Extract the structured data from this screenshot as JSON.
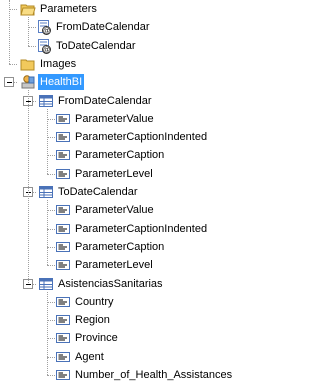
{
  "tree": {
    "parameters_folder": {
      "label": "Parameters",
      "icon": "folder-open-icon",
      "children": [
        {
          "label": "FromDateCalendar",
          "icon": "parameter-icon"
        },
        {
          "label": "ToDateCalendar",
          "icon": "parameter-icon"
        }
      ]
    },
    "images_folder": {
      "label": "Images",
      "icon": "folder-icon"
    },
    "datasource": {
      "label": "HealthBI",
      "icon": "data-source-icon",
      "selected": true,
      "datasets": [
        {
          "label": "FromDateCalendar",
          "icon": "dataset-icon",
          "fields": [
            "ParameterValue",
            "ParameterCaptionIndented",
            "ParameterCaption",
            "ParameterLevel"
          ]
        },
        {
          "label": "ToDateCalendar",
          "icon": "dataset-icon",
          "fields": [
            "ParameterValue",
            "ParameterCaptionIndented",
            "ParameterCaption",
            "ParameterLevel"
          ]
        },
        {
          "label": "AsistenciasSanitarias",
          "icon": "dataset-icon",
          "fields": [
            "Country",
            "Region",
            "Province",
            "Agent",
            "Number_of_Health_Assistances"
          ]
        }
      ]
    }
  },
  "colors": {
    "selection": "#3399ff",
    "folder": "#f2c95c",
    "field_icon": "#4a72b8"
  }
}
